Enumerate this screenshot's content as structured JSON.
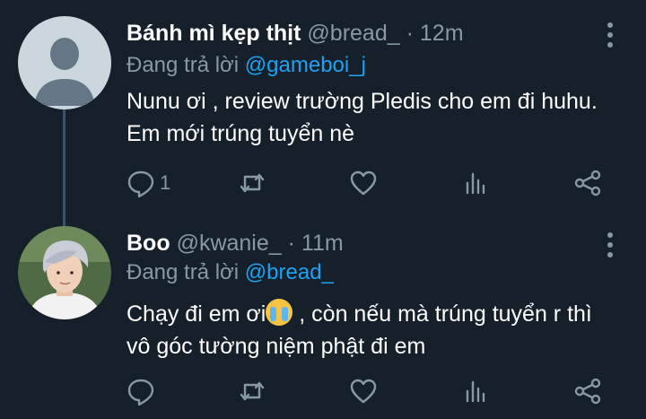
{
  "tweets": [
    {
      "display_name": "Bánh mì kẹp thịt",
      "handle": "@bread_",
      "separator": "·",
      "time": "12m",
      "reply_prefix": "Đang trả lời",
      "reply_to": "@gameboi_j",
      "text": "Nunu ơi , review trường Pledis cho em đi huhu. Em mới trúng tuyển nè",
      "reply_count": "1",
      "avatar": "default-profile-avatar"
    },
    {
      "display_name": "Boo",
      "handle": "@kwanie_",
      "separator": "·",
      "time": "11m",
      "reply_prefix": "Đang trả lời",
      "reply_to": "@bread_",
      "text_before_emoji": "Chạy đi em ơi",
      "emoji": "loudly-crying-face",
      "text_after_emoji": " , còn nếu mà trúng tuyển r thì vô góc tường niệm phật đi em",
      "reply_count": "",
      "avatar": "photo-avatar-silver-hair"
    }
  ],
  "icons": {
    "reply": "comment-icon",
    "retweet": "retweet-icon",
    "like": "heart-icon",
    "analytics": "analytics-icon",
    "share": "share-icon",
    "more": "more-vertical-icon"
  },
  "colors": {
    "background": "#15202b",
    "muted": "#8899a6",
    "link": "#1da1f2",
    "text": "#ffffff"
  }
}
